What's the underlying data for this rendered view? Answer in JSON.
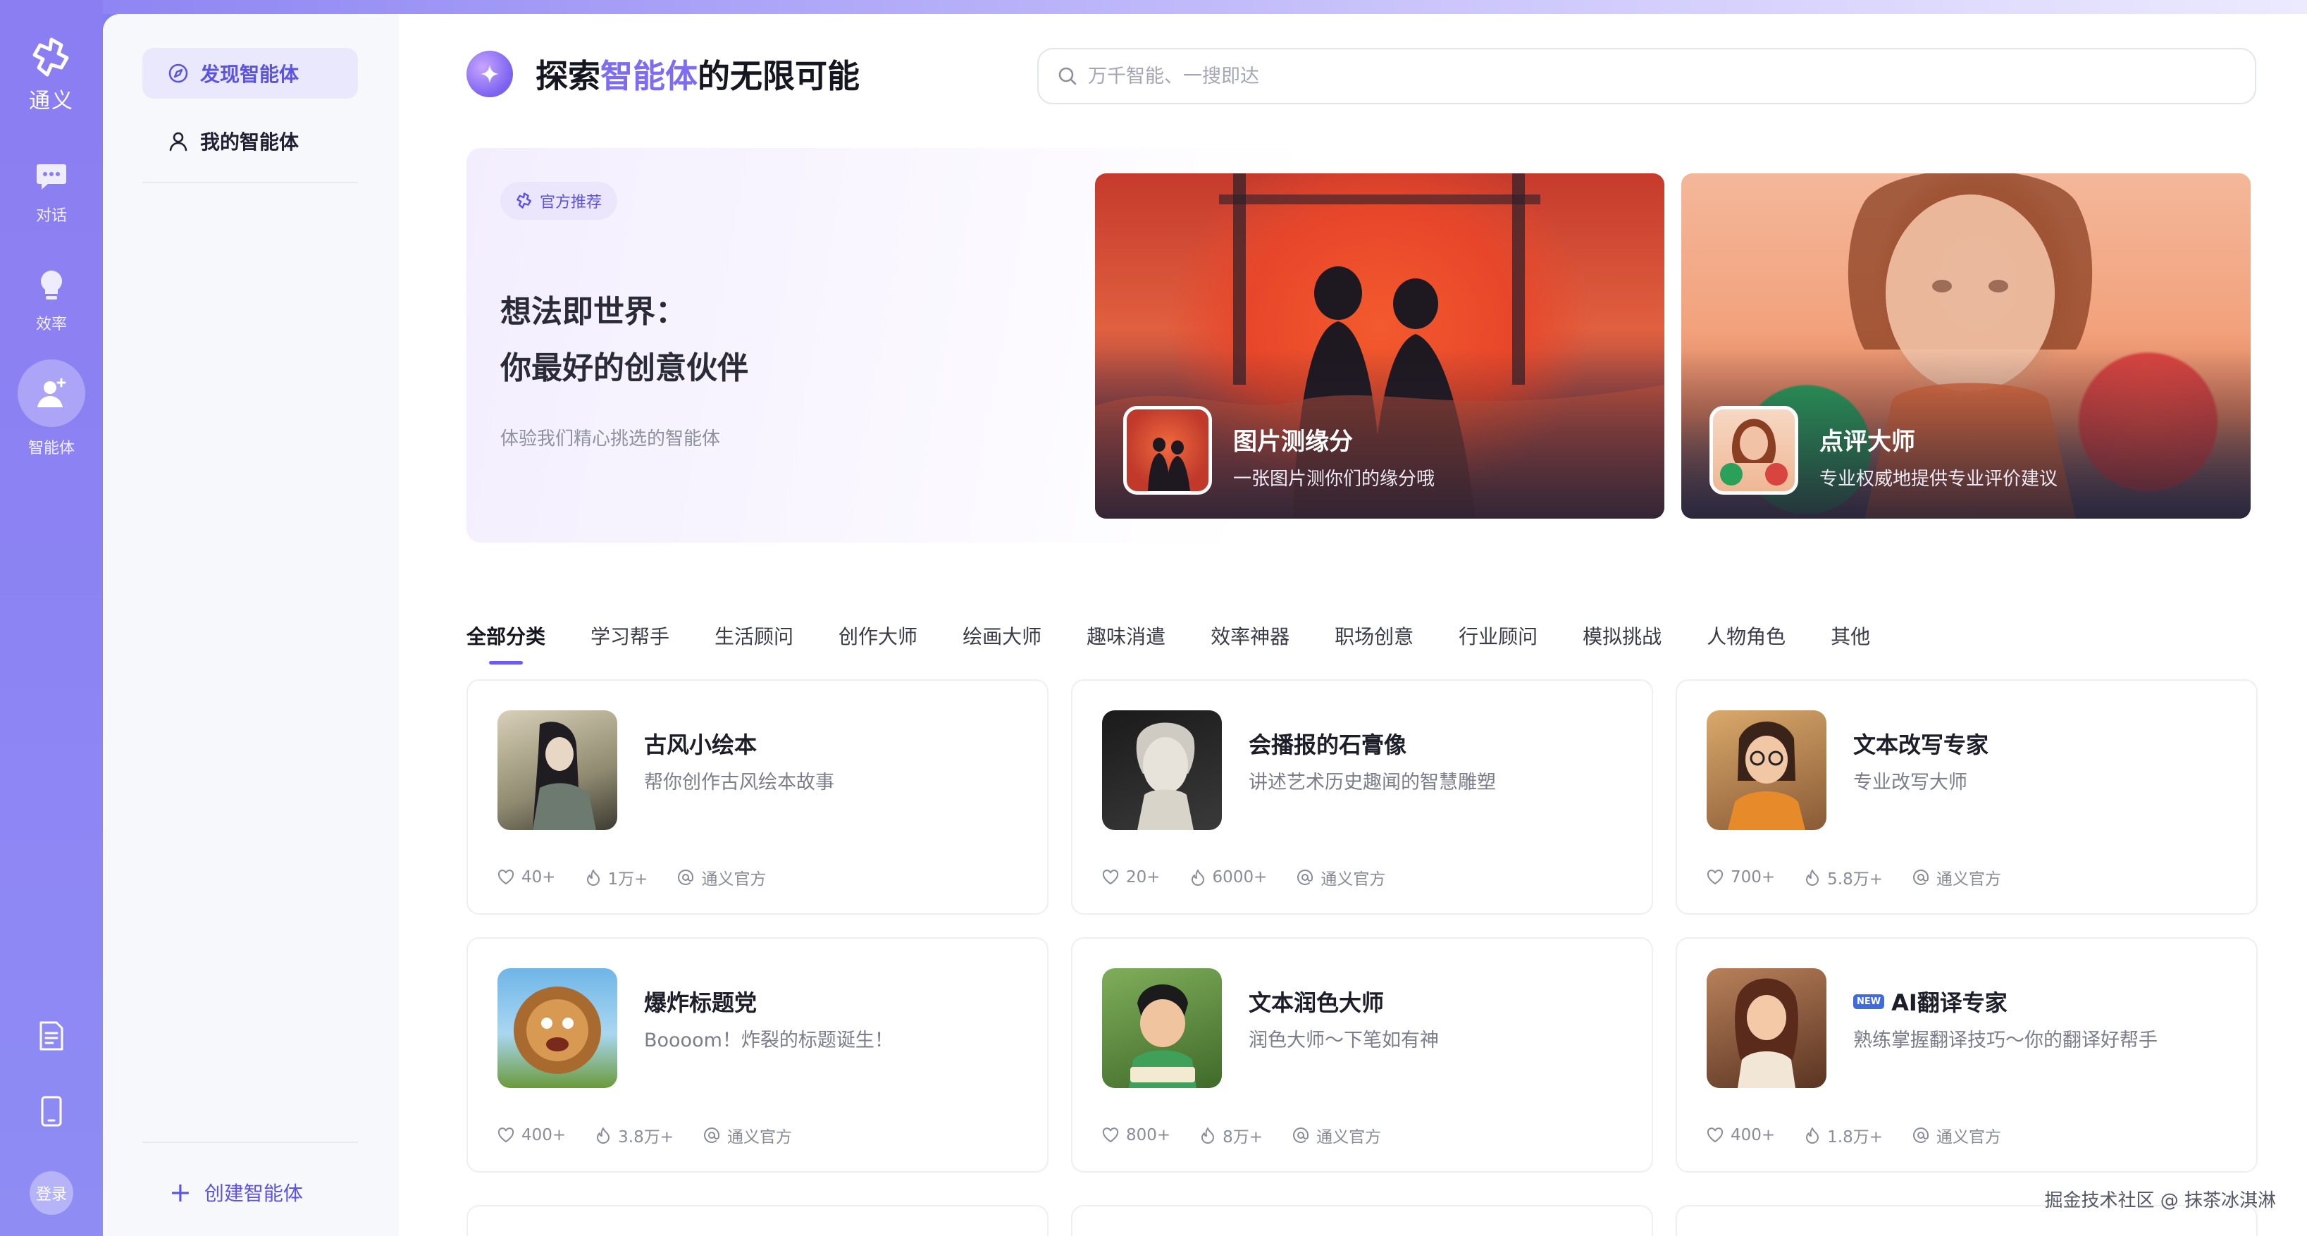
{
  "rail": {
    "logo_text": "通义",
    "items": [
      {
        "label": "对话",
        "icon": "chat-icon"
      },
      {
        "label": "效率",
        "icon": "lightbulb-icon"
      },
      {
        "label": "智能体",
        "icon": "agent-icon"
      }
    ],
    "bottom": {
      "login_label": "登录"
    }
  },
  "sidebar": {
    "items": [
      {
        "label": "发现智能体",
        "icon": "compass-icon"
      },
      {
        "label": "我的智能体",
        "icon": "user-icon"
      }
    ],
    "create_label": "创建智能体"
  },
  "header": {
    "title_prefix": "探索",
    "title_highlight": "智能体",
    "title_suffix": "的无限可能",
    "search_placeholder": "万千智能、一搜即达"
  },
  "banner": {
    "pill": "官方推荐",
    "line1": "想法即世界：",
    "line2": "你最好的创意伙伴",
    "sub": "体验我们精心挑选的智能体",
    "featured": [
      {
        "name": "图片测缘分",
        "desc": "一张图片测你们的缘分哦"
      },
      {
        "name": "点评大师",
        "desc": "专业权威地提供专业评价建议"
      }
    ]
  },
  "tabs": [
    "全部分类",
    "学习帮手",
    "生活顾问",
    "创作大师",
    "绘画大师",
    "趣味消遣",
    "效率神器",
    "职场创意",
    "行业顾问",
    "模拟挑战",
    "人物角色",
    "其他"
  ],
  "cards": [
    {
      "title": "古风小绘本",
      "desc": "帮你创作古风绘本故事",
      "likes": "40+",
      "uses": "1万+",
      "author": "通义官方"
    },
    {
      "title": "会播报的石膏像",
      "desc": "讲述艺术历史趣闻的智慧雕塑",
      "likes": "20+",
      "uses": "6000+",
      "author": "通义官方"
    },
    {
      "title": "文本改写专家",
      "desc": "专业改写大师",
      "likes": "700+",
      "uses": "5.8万+",
      "author": "通义官方"
    },
    {
      "title": "爆炸标题党",
      "desc": "Boooom！炸裂的标题诞生！",
      "likes": "400+",
      "uses": "3.8万+",
      "author": "通义官方"
    },
    {
      "title": "文本润色大师",
      "desc": "润色大师～下笔如有神",
      "likes": "800+",
      "uses": "8万+",
      "author": "通义官方"
    },
    {
      "title": "AI翻译专家",
      "desc": "熟练掌握翻译技巧～你的翻译好帮手",
      "likes": "400+",
      "uses": "1.8万+",
      "author": "通义官方",
      "badge": "NEW"
    }
  ],
  "watermark": "掘金技术社区 @ 抹茶冰淇淋",
  "colors": {
    "accent": "#6a5df0",
    "rail": "#8b7df2",
    "highlight": "#7e6cf2"
  }
}
